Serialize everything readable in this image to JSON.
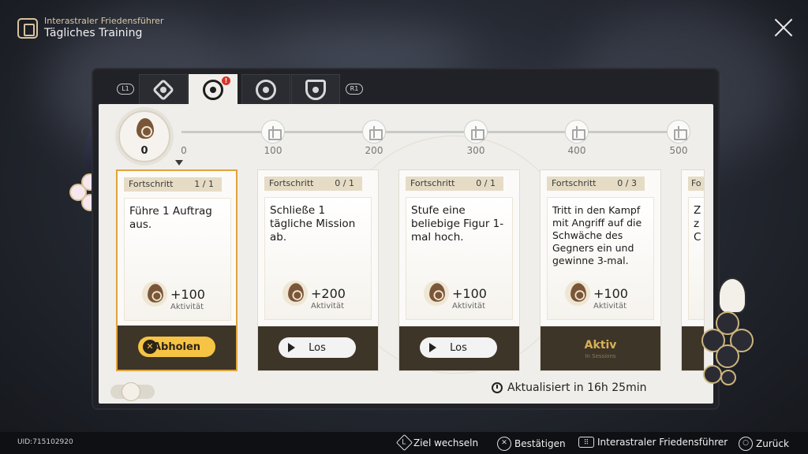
{
  "header": {
    "subtitle": "Interastraler Friedensführer",
    "title": "Tägliches Training"
  },
  "tabs": {
    "left_key": "L1",
    "right_key": "R1",
    "items": [
      {
        "icon": "diamond-blocks-icon",
        "active": false
      },
      {
        "icon": "compass-wheel-icon",
        "active": true,
        "badge": "!"
      },
      {
        "icon": "triangle-target-icon",
        "active": false
      },
      {
        "icon": "shield-sword-icon",
        "active": false
      }
    ]
  },
  "progress": {
    "current": "0",
    "fraction": 0,
    "milestones": [
      "0",
      "100",
      "200",
      "300",
      "400",
      "500"
    ]
  },
  "cards": [
    {
      "header": "Fortschritt",
      "count": "1 / 1",
      "desc": "Führe 1 Auftrag aus.",
      "reward": "+100",
      "reward_label": "Aktivität",
      "button": "Abholen",
      "state": "claim"
    },
    {
      "header": "Fortschritt",
      "count": "0 / 1",
      "desc": "Schließe 1 tägliche Mission ab.",
      "reward": "+200",
      "reward_label": "Aktivität",
      "button": "Los",
      "state": "go"
    },
    {
      "header": "Fortschritt",
      "count": "0 / 1",
      "desc": "Stufe eine beliebige Figur 1-mal hoch.",
      "reward": "+100",
      "reward_label": "Aktivität",
      "button": "Los",
      "state": "go"
    },
    {
      "header": "Fortschritt",
      "count": "0 / 3",
      "desc": "Tritt in den Kampf mit Angriff auf die Schwäche des Gegners ein und gewinne 3-mal.",
      "reward": "+100",
      "reward_label": "Aktivität",
      "button": "Aktiv",
      "sub": "In Sessions",
      "state": "active"
    },
    {
      "header": "Fo",
      "desc": "Z z C",
      "state": "partial"
    }
  ],
  "refresh": "Aktualisiert in 16h 25min",
  "bottom": {
    "uid": "UID:715102920",
    "hints": [
      {
        "key": "L",
        "label": "Ziel wechseln"
      },
      {
        "key": "✕",
        "label": "Bestätigen"
      },
      {
        "key": "⠿",
        "label": "Interastraler Friedensführer"
      },
      {
        "key": "○",
        "label": "Zurück"
      }
    ]
  },
  "colors": {
    "accent": "#f5c445",
    "selected_border": "#e0a33d",
    "card_footer": "#3e3529",
    "badge": "#d9332b"
  }
}
